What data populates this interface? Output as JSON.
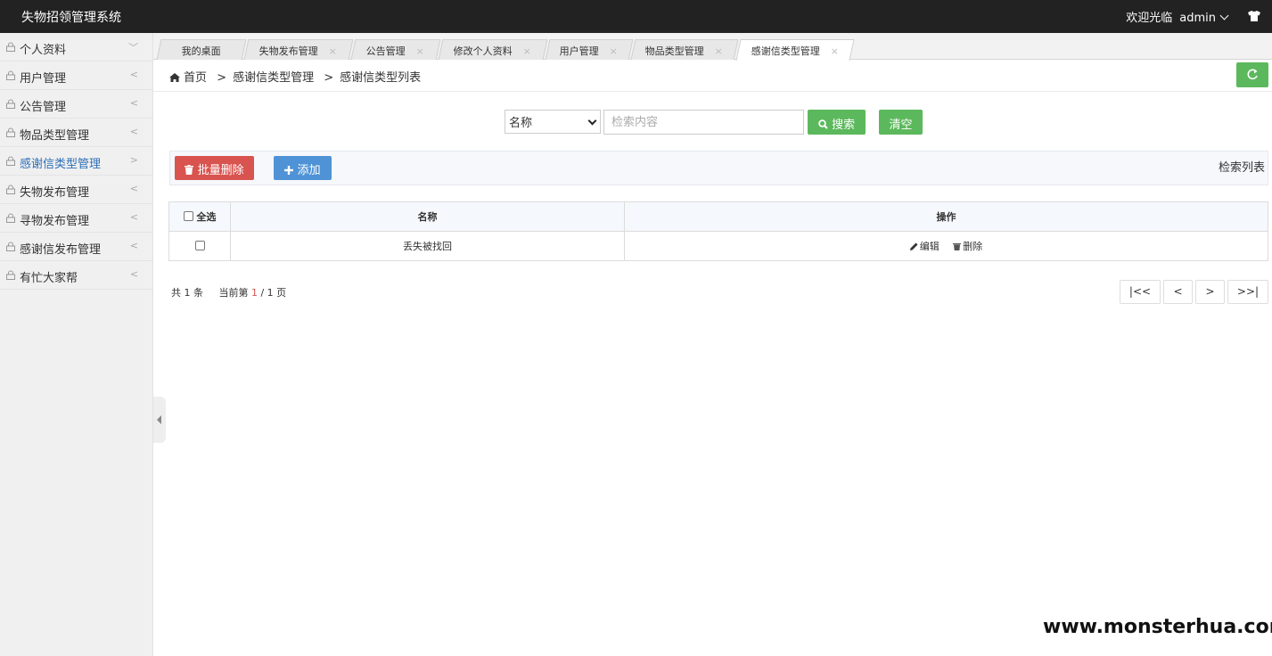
{
  "header": {
    "app_title": "失物招领管理系统",
    "welcome_text": "欢迎光临",
    "username": "admin"
  },
  "sidebar": {
    "items": [
      {
        "label": "个人资料",
        "arrow": "﹀",
        "active": false
      },
      {
        "label": "用户管理",
        "arrow": "<",
        "active": false
      },
      {
        "label": "公告管理",
        "arrow": "<",
        "active": false
      },
      {
        "label": "物品类型管理",
        "arrow": "<",
        "active": false
      },
      {
        "label": "感谢信类型管理",
        "arrow": ">",
        "active": true
      },
      {
        "label": "失物发布管理",
        "arrow": "<",
        "active": false
      },
      {
        "label": "寻物发布管理",
        "arrow": "<",
        "active": false
      },
      {
        "label": "感谢信发布管理",
        "arrow": "<",
        "active": false
      },
      {
        "label": "有忙大家帮",
        "arrow": "<",
        "active": false
      }
    ]
  },
  "tabs": [
    {
      "label": "我的桌面",
      "closable": false
    },
    {
      "label": "失物发布管理",
      "closable": true
    },
    {
      "label": "公告管理",
      "closable": true
    },
    {
      "label": "修改个人资料",
      "closable": true
    },
    {
      "label": "用户管理",
      "closable": true
    },
    {
      "label": "物品类型管理",
      "closable": true
    },
    {
      "label": "感谢信类型管理",
      "closable": true,
      "active": true
    }
  ],
  "tab_close_glyph": "×",
  "breadcrumb": {
    "home": "首页",
    "level1": "感谢信类型管理",
    "level2": "感谢信类型列表",
    "separator": ">"
  },
  "search": {
    "field_selected": "名称",
    "placeholder": "检索内容",
    "search_label": "搜索",
    "clear_label": "清空"
  },
  "toolbar": {
    "batch_delete_label": "批量删除",
    "add_label": "添加",
    "list_label": "检索列表"
  },
  "table": {
    "headers": {
      "select_all": "全选",
      "name": "名称",
      "actions": "操作"
    },
    "rows": [
      {
        "name": "丢失被找回",
        "edit_label": "编辑",
        "delete_label": "删除"
      }
    ]
  },
  "pagination": {
    "total_prefix": "共",
    "total": "1",
    "total_suffix": "条",
    "current_prefix": "当前第",
    "current": "1",
    "pages": "/ 1 页",
    "first": "|<<",
    "prev": "<",
    "next": ">",
    "last": ">>|"
  },
  "watermark": "www.monsterhua.com",
  "colors": {
    "topbar": "#222222",
    "green": "#5cb85c",
    "red": "#d9534f",
    "blue": "#4f93d6",
    "active_link": "#2c6fb7"
  }
}
